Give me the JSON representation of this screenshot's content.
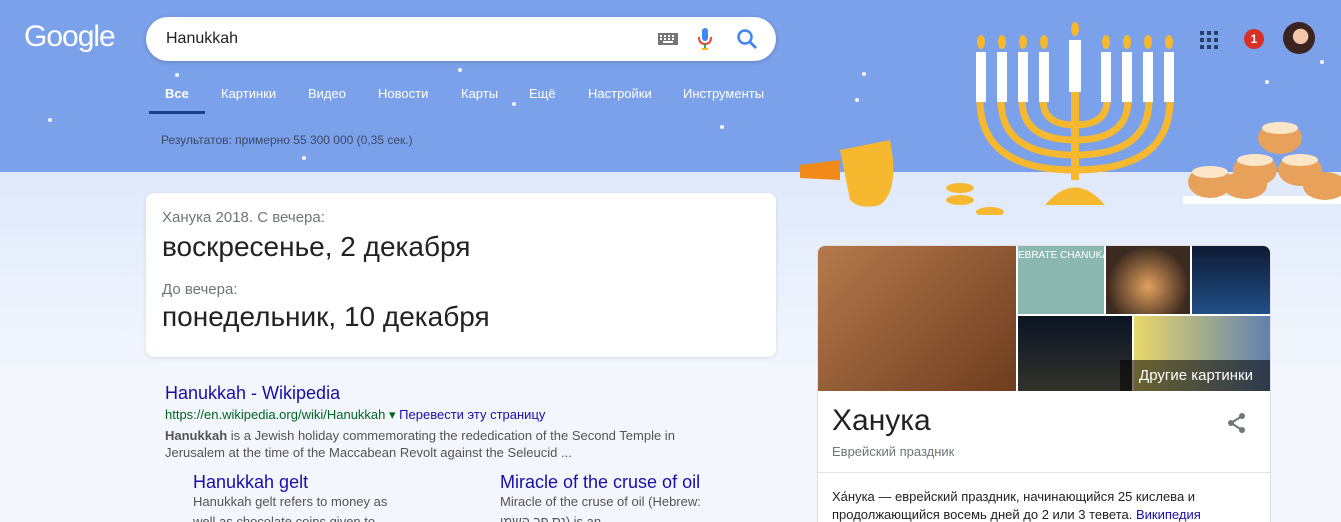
{
  "logo": "Google",
  "search": {
    "query": "Hanukkah"
  },
  "tabs": [
    "Все",
    "Картинки",
    "Видео",
    "Новости",
    "Карты",
    "Ещё",
    "Настройки",
    "Инструменты"
  ],
  "results_count": "Результатов: примерно 55 300 000 (0,35 сек.)",
  "notifications": "1",
  "date_card": {
    "from_label": "Ханука 2018. С вечера:",
    "from_date": "воскресенье, 2 декабря",
    "to_label": "До вечера:",
    "to_date": "понедельник, 10 декабря"
  },
  "result": {
    "title": "Hanukkah - Wikipedia",
    "url": "https://en.wikipedia.org/wiki/Hanukkah",
    "url_arrow": "▾",
    "translate": "Перевести эту страницу",
    "snippet_bold": "Hanukkah",
    "snippet": " is a Jewish holiday commemorating the rededication of the Second Temple in Jerusalem at the time of the Maccabean Revolt against the Seleucid ...",
    "sublinks": [
      {
        "title": "Hanukkah gelt",
        "snippet": "Hanukkah gelt refers to money as well as chocolate coins given to"
      },
      {
        "title": "Miracle of the cruse of oil",
        "snippet": "Miracle of the cruse of oil (Hebrew: נס פך השמן) is an"
      }
    ]
  },
  "knowledge_panel": {
    "more_images": "Другие картинки",
    "image_banner_text": "EBRATE CHANUKAH",
    "title": "Ханука",
    "subtitle": "Еврейский праздник",
    "description": "Ха́нука — еврейский праздник, начинающийся 25 кислева и продолжающийся восемь дней до 2 или 3 тевета.",
    "source": "Википедия"
  },
  "colors": {
    "banner": "#7aa1ea",
    "link": "#1a0dab",
    "url": "#006621",
    "menorah": "#f5b82e"
  }
}
